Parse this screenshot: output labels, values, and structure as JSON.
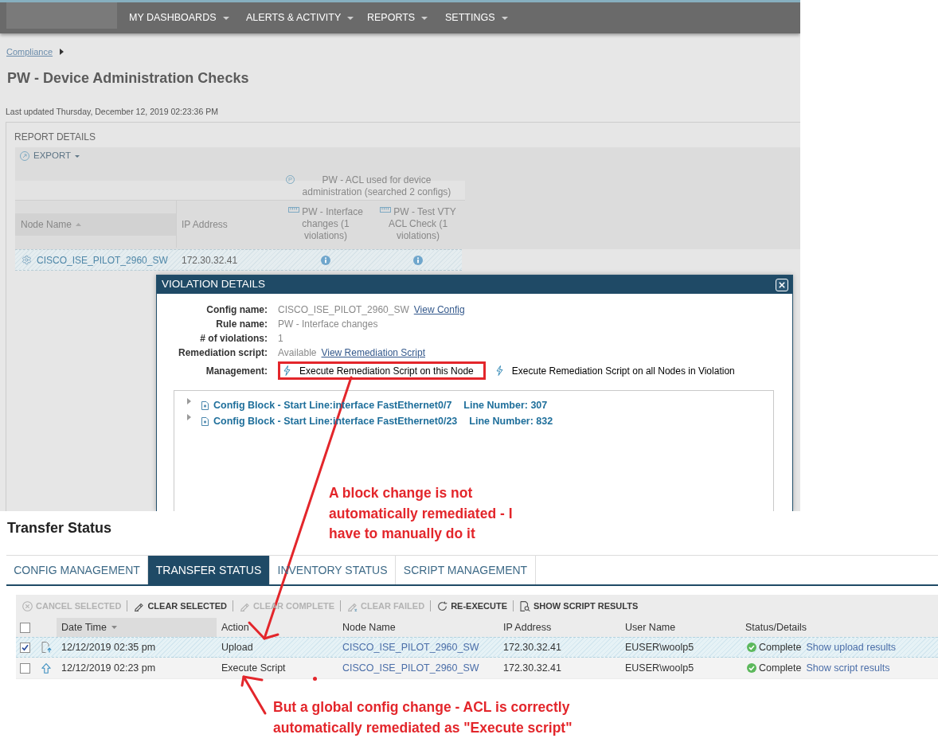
{
  "top_nav": {
    "menus": [
      {
        "label": "MY DASHBOARDS"
      },
      {
        "label": "ALERTS & ACTIVITY"
      },
      {
        "label": "REPORTS"
      },
      {
        "label": "SETTINGS"
      }
    ]
  },
  "breadcrumb": [
    {
      "label": "Compliance"
    }
  ],
  "page_title": "PW - Device Administration Checks",
  "last_updated": "Last updated Thursday, December 12, 2019 02:23:36 PM",
  "report": {
    "title": "REPORT DETAILS",
    "export": "EXPORT",
    "column_group": {
      "badge": "P",
      "label": "PW - ACL used for device administration (searched 2 configs)"
    },
    "columns": [
      {
        "label": "Node Name",
        "kind": "field",
        "sorted": true,
        "ascending": true
      },
      {
        "label": "IP Address",
        "kind": "field",
        "sorted": false
      },
      {
        "label": "PW - Interface changes (1 violations)",
        "kind": "rule"
      },
      {
        "label": "PW - Test VTY ACL Check (1 violations)",
        "kind": "rule"
      }
    ],
    "rows": [
      {
        "selected": true,
        "node_name": "CISCO_ISE_PILOT_2960_SW",
        "ip_address": "172.30.32.41"
      }
    ]
  },
  "violation_dialog": {
    "title": "VIOLATION DETAILS",
    "fields": [
      {
        "label": "Config name:",
        "value": "CISCO_ISE_PILOT_2960_SW",
        "link": "View Config"
      },
      {
        "label": "Rule name:",
        "value": "PW - Interface changes"
      },
      {
        "label": "# of violations:",
        "value": "1"
      },
      {
        "label": "Remediation script:",
        "value": "Available",
        "link": "View Remediation Script"
      }
    ],
    "management": {
      "label": "Management:",
      "actions": [
        {
          "label": "Execute Remediation Script on this Node",
          "highlighted": true
        },
        {
          "label": "Execute Remediation Script on all Nodes in Violation",
          "highlighted": false
        }
      ]
    },
    "config_blocks": [
      {
        "label": "Config Block - Start Line:interface FastEthernet0/7",
        "line_number": "Line Number: 307",
        "expanded": false
      },
      {
        "label": "Config Block - Start Line:interface FastEthernet0/23",
        "line_number": "Line Number: 832",
        "expanded": false
      }
    ]
  },
  "transfer": {
    "title": "Transfer Status",
    "tabs": [
      {
        "label": "CONFIG MANAGEMENT",
        "selected": false
      },
      {
        "label": "TRANSFER STATUS",
        "selected": true
      },
      {
        "label": "INVENTORY STATUS",
        "selected": false
      },
      {
        "label": "SCRIPT MANAGEMENT",
        "selected": false
      }
    ],
    "toolbar": [
      {
        "label": "CANCEL SELECTED",
        "disabled": true
      },
      {
        "label": "CLEAR SELECTED",
        "disabled": false
      },
      {
        "label": "CLEAR COMPLETE",
        "disabled": true
      },
      {
        "label": "CLEAR FAILED",
        "disabled": true
      },
      {
        "label": "RE-EXECUTE",
        "disabled": false
      },
      {
        "label": "SHOW SCRIPT RESULTS",
        "disabled": false
      }
    ],
    "table": {
      "select_all": {
        "checked": false
      },
      "columns": [
        {
          "label": "Date Time",
          "sorted": true,
          "ascending": false
        },
        {
          "label": "Action",
          "sorted": false
        },
        {
          "label": "Node Name",
          "sorted": false
        },
        {
          "label": "IP Address",
          "sorted": false
        },
        {
          "label": "User Name",
          "sorted": false
        },
        {
          "label": "Status/Details",
          "sorted": false
        }
      ],
      "rows": [
        {
          "kind": "upload",
          "selected": true,
          "checked": true,
          "date_time": "12/12/2019 02:35 pm",
          "action": "Upload",
          "node_name": "CISCO_ISE_PILOT_2960_SW",
          "ip_address": "172.30.32.41",
          "user_name": "EUSER\\woolp5",
          "status": "Complete",
          "details_link": "Show upload results"
        },
        {
          "kind": "script",
          "selected": false,
          "checked": false,
          "date_time": "12/12/2019 02:23 pm",
          "action": "Execute Script",
          "node_name": "CISCO_ISE_PILOT_2960_SW",
          "ip_address": "172.30.32.41",
          "user_name": "EUSER\\woolp5",
          "status": "Complete",
          "details_link": "Show script results"
        }
      ]
    }
  },
  "annotations": [
    {
      "text": "A block change is not\nautomatically remediated - I\nhave to manually do it"
    },
    {
      "text": "But a global config change - ACL is correctly\nautomatically remediated as \"Execute script\""
    }
  ]
}
